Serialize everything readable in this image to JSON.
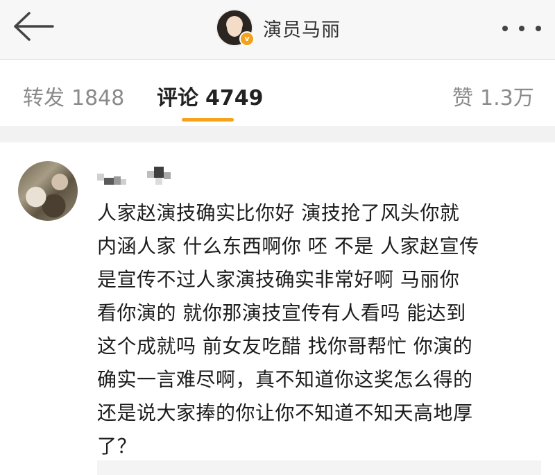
{
  "header": {
    "back_icon": "arrow-left-icon",
    "account_name": "演员马丽",
    "verified_badge": "v",
    "more_icon": "more-dots-icon"
  },
  "tabs": [
    {
      "label": "转发",
      "count": "1848",
      "active": false
    },
    {
      "label": "评论",
      "count": "4749",
      "active": true
    },
    {
      "label": "赞",
      "count": "1.3万",
      "active": false
    }
  ],
  "accent_color": "#f7a21b",
  "comment": {
    "username": "",
    "text": "人家赵演技确实比你好 演技抢了风头你就\n内涵人家 什么东西啊你 呸 不是 人家赵宣传\n是宣传不过人家演技确实非常好啊 马丽你\n看你演的 就你那演技宣传有人看吗 能达到\n这个成就吗 前女友吃醋 找你哥帮忙 你演的\n确实一言难尽啊，真不知道你这奖怎么得的\n还是说大家捧的你让你不知道不知天高地厚\n了？"
  }
}
